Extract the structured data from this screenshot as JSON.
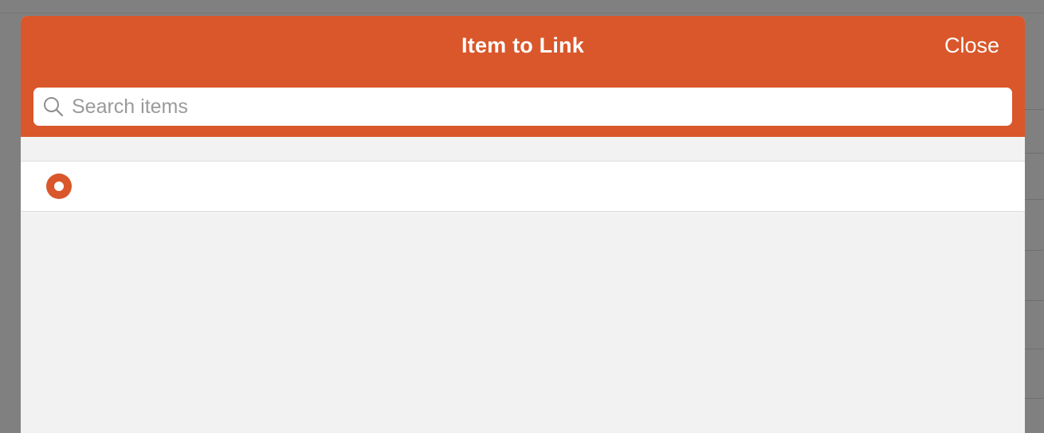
{
  "colors": {
    "accent": "#d9572b",
    "backdrop": "#808080",
    "list_background": "#f2f2f2",
    "row_background": "#ffffff"
  },
  "modal": {
    "title": "Item to Link",
    "close_label": "Close",
    "search": {
      "placeholder": "Search items",
      "value": "",
      "icon": "search-icon"
    },
    "items": [
      {
        "label": "",
        "selected": true,
        "icon": "radio-selected-icon"
      }
    ]
  }
}
